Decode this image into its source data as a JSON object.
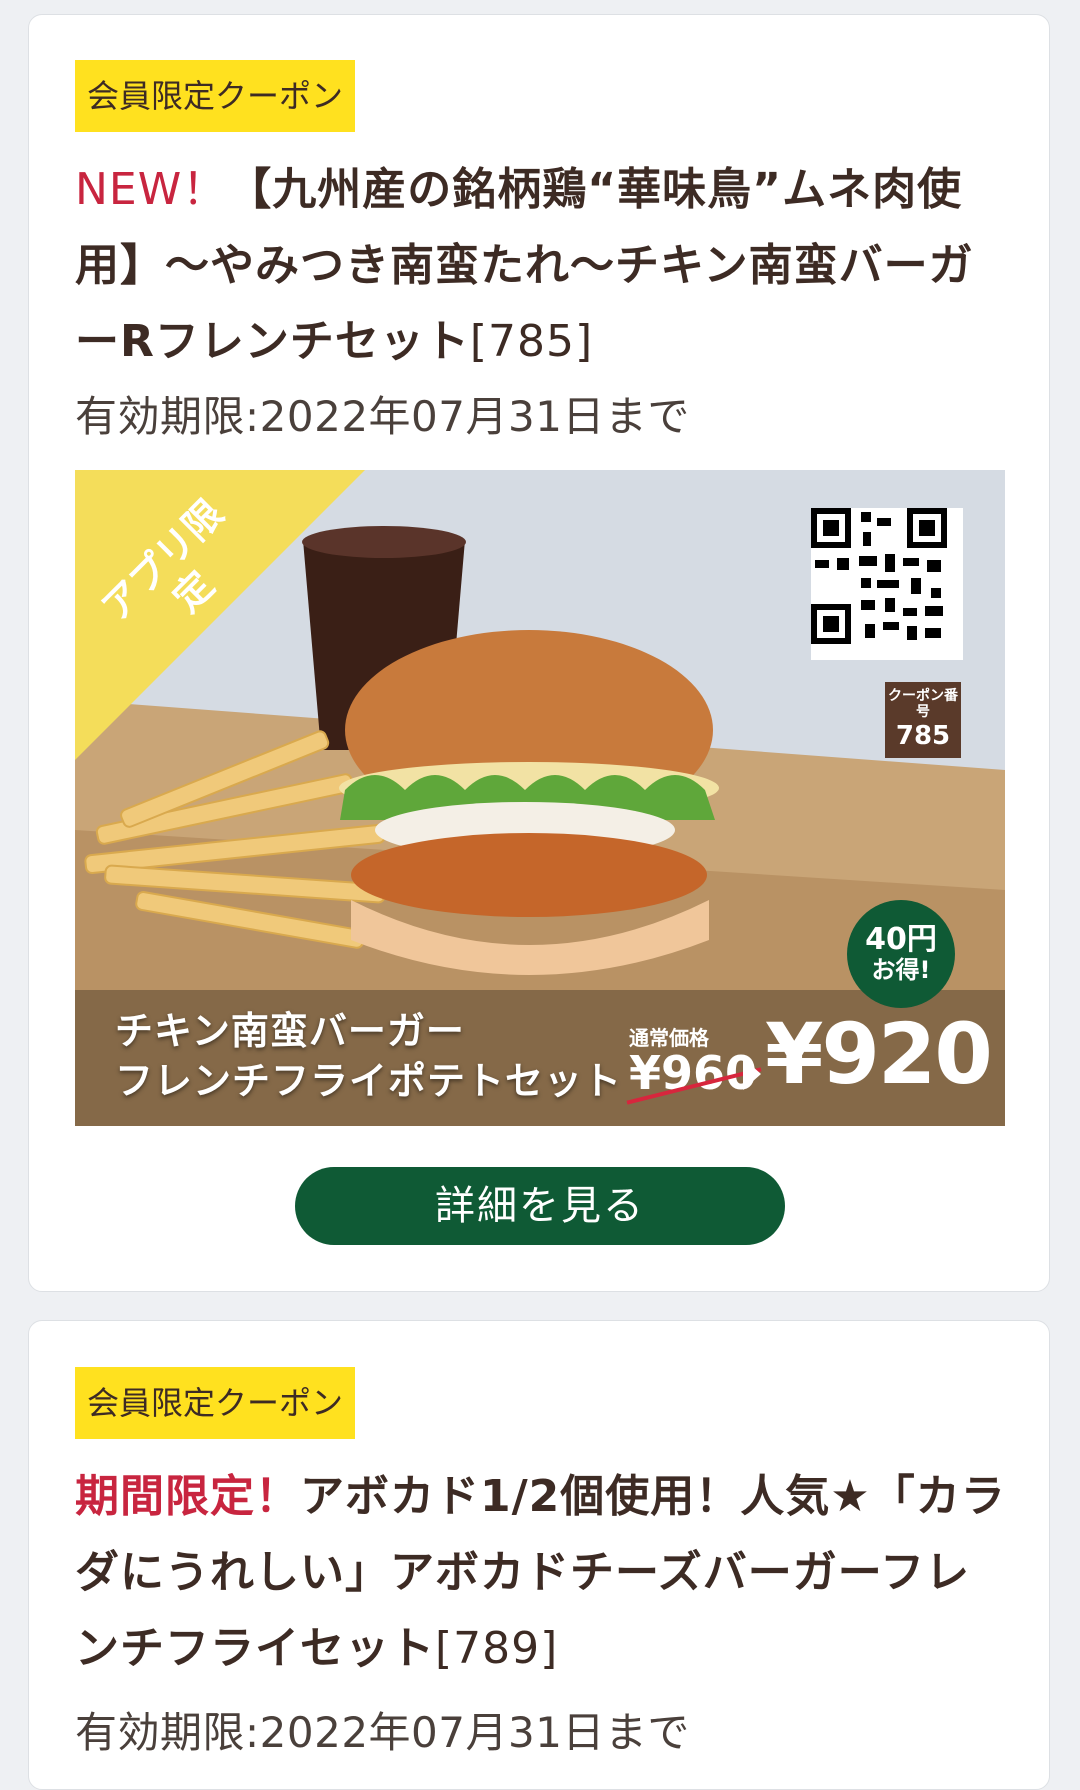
{
  "coupons": [
    {
      "badge": "会員限定クーポン",
      "tag": "NEW！",
      "title": "【九州産の銘柄鶏“華味鳥”ムネ肉使用】〜やみつき南蛮たれ〜チキン南蛮バーガーRフレンチセット",
      "code": "[785]",
      "expiry": "有効期限:2022年07月31日まで",
      "image": {
        "ribbon": "アプリ限定",
        "coupon_no_label": "クーポン番号",
        "coupon_no": "785",
        "save_amount": "40円",
        "save_label": "お得!",
        "product_line1": "チキン南蛮バーガー",
        "product_line2": "フレンチフライポテトセット",
        "regular_label": "通常価格",
        "regular_price": "¥960",
        "sale_price": "¥920"
      },
      "detail_button": "詳細を見る"
    },
    {
      "badge": "会員限定クーポン",
      "tag": "期間限定！",
      "title": "アボカド1/2個使用！人気★「カラダにうれしい」アボカドチーズバーガーフレンチフライセット",
      "code": "[789]",
      "expiry": "有効期限:2022年07月31日まで"
    }
  ],
  "colors": {
    "badge": "#ffe11f",
    "accent_red": "#c8253f",
    "brand_green": "#0f5a35",
    "text_brown": "#3d2b24"
  }
}
